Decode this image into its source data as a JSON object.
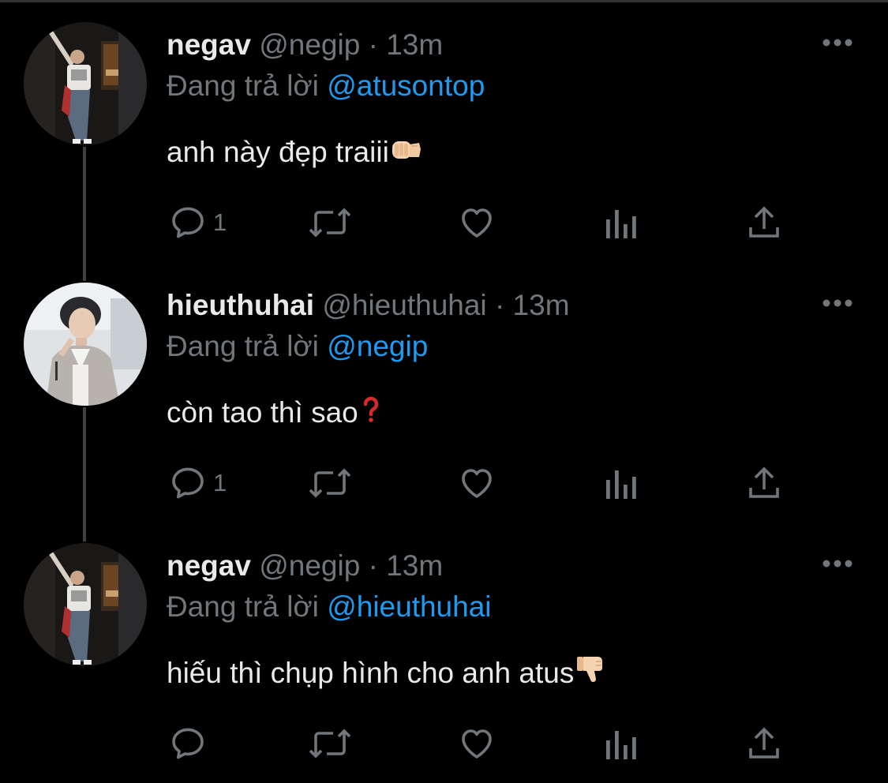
{
  "tweets": [
    {
      "display_name": "negav",
      "handle": "@negip",
      "separator": "·",
      "time": "13m",
      "reply_prefix": "Đang trả lời",
      "reply_to": "@atusontop",
      "text": "anh này đẹp traiii",
      "text_emoji": "fist-bump-emoji",
      "reply_count": "1",
      "avatar": "avatar-negav"
    },
    {
      "display_name": "hieuthuhai",
      "handle": "@hieuthuhai",
      "separator": "·",
      "time": "13m",
      "reply_prefix": "Đang trả lời",
      "reply_to": "@negip",
      "text": "còn tao thì sao",
      "text_emoji": "red-question-mark-emoji",
      "reply_count": "1",
      "avatar": "avatar-hieuthuhai"
    },
    {
      "display_name": "negav",
      "handle": "@negip",
      "separator": "·",
      "time": "13m",
      "reply_prefix": "Đang trả lời",
      "reply_to": "@hieuthuhai",
      "text": "hiếu thì chụp hình cho anh atus",
      "text_emoji": "thumbs-down-emoji",
      "reply_count": "",
      "avatar": "avatar-negav"
    }
  ],
  "icons": {
    "more": "more-horizontal-icon",
    "reply": "reply-bubble-icon",
    "retweet": "retweet-icon",
    "like": "heart-icon",
    "analytics": "analytics-icon",
    "share": "share-icon"
  },
  "colors": {
    "background": "#000000",
    "primary_text": "#e7e9ea",
    "secondary_text": "#71767b",
    "mention": "#1d9bf0",
    "thread_line": "#3e4144"
  }
}
